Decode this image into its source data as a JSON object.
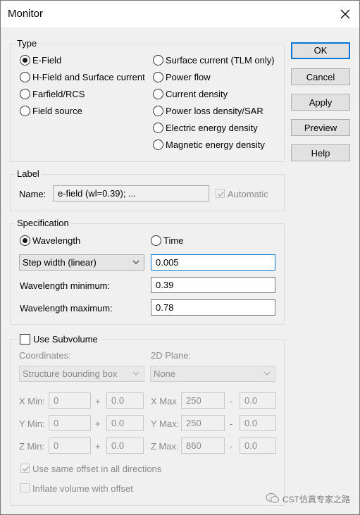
{
  "window": {
    "title": "Monitor"
  },
  "buttons": {
    "ok": "OK",
    "cancel": "Cancel",
    "apply": "Apply",
    "preview": "Preview",
    "help": "Help"
  },
  "type_group": {
    "title": "Type",
    "left": [
      "E-Field",
      "H-Field and Surface current",
      "Farfield/RCS",
      "Field source"
    ],
    "right": [
      "Surface current (TLM only)",
      "Power flow",
      "Current density",
      "Power loss density/SAR",
      "Electric energy density",
      "Magnetic energy density"
    ],
    "selected": "E-Field"
  },
  "label_group": {
    "title": "Label",
    "name_label": "Name:",
    "name_value": "e-field (wl=0.39); ...",
    "automatic_label": "Automatic",
    "automatic_checked": true
  },
  "spec_group": {
    "title": "Specification",
    "wavelength_label": "Wavelength",
    "time_label": "Time",
    "selected": "Wavelength",
    "step_mode": "Step width (linear)",
    "step_value": "0.005",
    "wl_min_label": "Wavelength minimum:",
    "wl_min_value": "0.39",
    "wl_max_label": "Wavelength maximum:",
    "wl_max_value": "0.78"
  },
  "subvolume": {
    "title": "Use Subvolume",
    "checked": false,
    "coordinates_label": "Coordinates:",
    "coordinates_value": "Structure bounding box",
    "plane_label": "2D Plane:",
    "plane_value": "None",
    "plus": "+",
    "minus": "-",
    "rows": [
      {
        "min_label": "X Min:",
        "min_value": "0",
        "min_offset": "0.0",
        "max_label": "X Max",
        "max_value": "250",
        "max_offset": "0.0"
      },
      {
        "min_label": "Y Min:",
        "min_value": "0",
        "min_offset": "0.0",
        "max_label": "Y Max:",
        "max_value": "250",
        "max_offset": "0.0"
      },
      {
        "min_label": "Z Min:",
        "min_value": "0",
        "min_offset": "0.0",
        "max_label": "Z Max:",
        "max_value": "860",
        "max_offset": "0.0"
      }
    ],
    "same_offset_label": "Use same offset in all directions",
    "same_offset_checked": true,
    "inflate_label": "Inflate volume with offset",
    "inflate_checked": false
  },
  "watermark": "CST仿真专家之路"
}
